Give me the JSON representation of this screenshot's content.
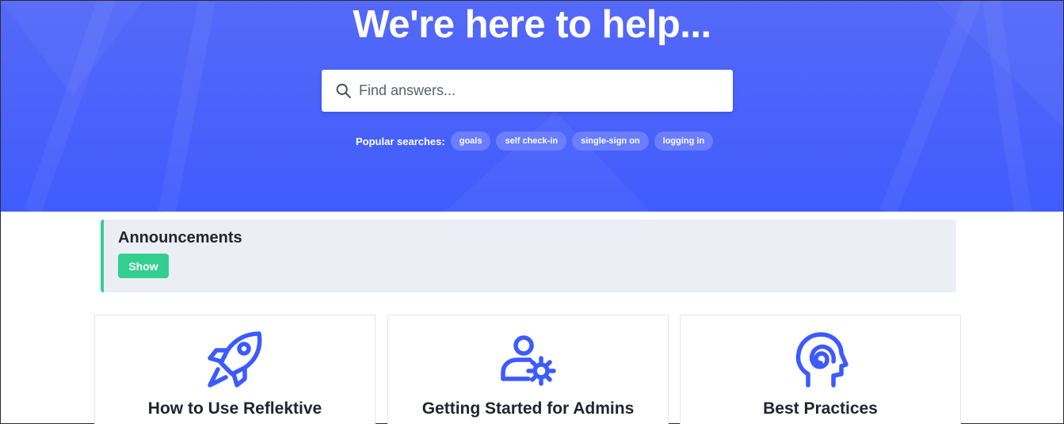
{
  "hero": {
    "title": "We're here to help...",
    "search_placeholder": "Find answers...",
    "popular_label": "Popular searches:",
    "popular_searches": [
      "goals",
      "self check-in",
      "single-sign on",
      "logging in"
    ]
  },
  "announcements": {
    "title": "Announcements",
    "show_label": "Show"
  },
  "cards": [
    {
      "title": "How to Use Reflektive",
      "icon": "rocket-icon"
    },
    {
      "title": "Getting Started for Admins",
      "icon": "user-gear-icon"
    },
    {
      "title": "Best Practices",
      "icon": "head-spiral-icon"
    }
  ],
  "colors": {
    "hero_bg": "#4a62fb",
    "accent_green": "#33cf91",
    "icon_blue": "#3d5afe",
    "announcement_bg": "#ebeef4"
  }
}
